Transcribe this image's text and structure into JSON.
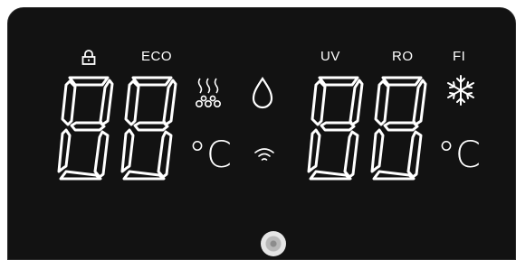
{
  "panel": {
    "left_labels": {
      "eco": "ECO"
    },
    "right_labels": {
      "uv": "UV",
      "ro": "RO",
      "fi": "FI"
    },
    "units": {
      "left_unit": "°C",
      "right_unit": "°C"
    },
    "icons": [
      "lock-icon",
      "heating-icon",
      "water-drop-icon",
      "wifi-icon",
      "snowflake-icon"
    ],
    "colors": {
      "background": "#121212",
      "segments": "#ffffff"
    }
  }
}
